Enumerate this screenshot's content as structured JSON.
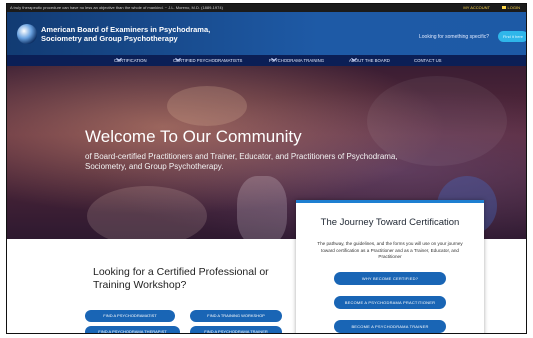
{
  "top_bar": {
    "quote": "A truly therapeutic procedure can have no less an objective than the whole of mankind. ~ J.L. Moreno, M.D. (1889-1974)",
    "my_account": "MY ACCOUNT",
    "login": "LOGIN"
  },
  "header": {
    "org_line1": "American Board of Examiners in Psychodrama,",
    "org_line2": "Sociometry and Group Psychotherapy",
    "search_prompt": "Looking for something specific?",
    "search_button": "Find it here"
  },
  "nav": {
    "items": [
      {
        "label": "CERTIFICATION"
      },
      {
        "label": "CERTIFIED PSYCHODRAMATISTS"
      },
      {
        "label": "PSYCHODRAMA TRAINING"
      },
      {
        "label": "ABOUT THE BOARD"
      },
      {
        "label": "CONTACT US"
      }
    ]
  },
  "hero": {
    "title": "Welcome To Our Community",
    "subtitle": "of Board-certified Practitioners and Trainer, Educator, and Practitioners of Psychodrama, Sociometry, and Group Psychotherapy."
  },
  "card": {
    "title": "The Journey Toward Certification",
    "text": "The pathway, the guidelines, and the forms you will use on your journey toward certification as a Practitioner and as a Trainer, Educator, and Practitioner",
    "buttons": [
      {
        "label": "WHY BECOME CERTIFIED?"
      },
      {
        "label": "BECOME A PSYCHODRAMA PRACTITIONER"
      },
      {
        "label": "BECOME A PSYCHODRAMA TRAINER"
      }
    ]
  },
  "lower": {
    "heading": "Looking for a Certified Professional or Training Workshop?",
    "buttons": [
      {
        "label": "FIND A PSYCHODRAMATIST"
      },
      {
        "label": "FIND A TRAINING WORKSHOP"
      },
      {
        "label": "FIND A PSYCHODRAMA THERAPIST"
      },
      {
        "label": "FIND A PSYCHODRAMA TRAINER"
      }
    ]
  }
}
